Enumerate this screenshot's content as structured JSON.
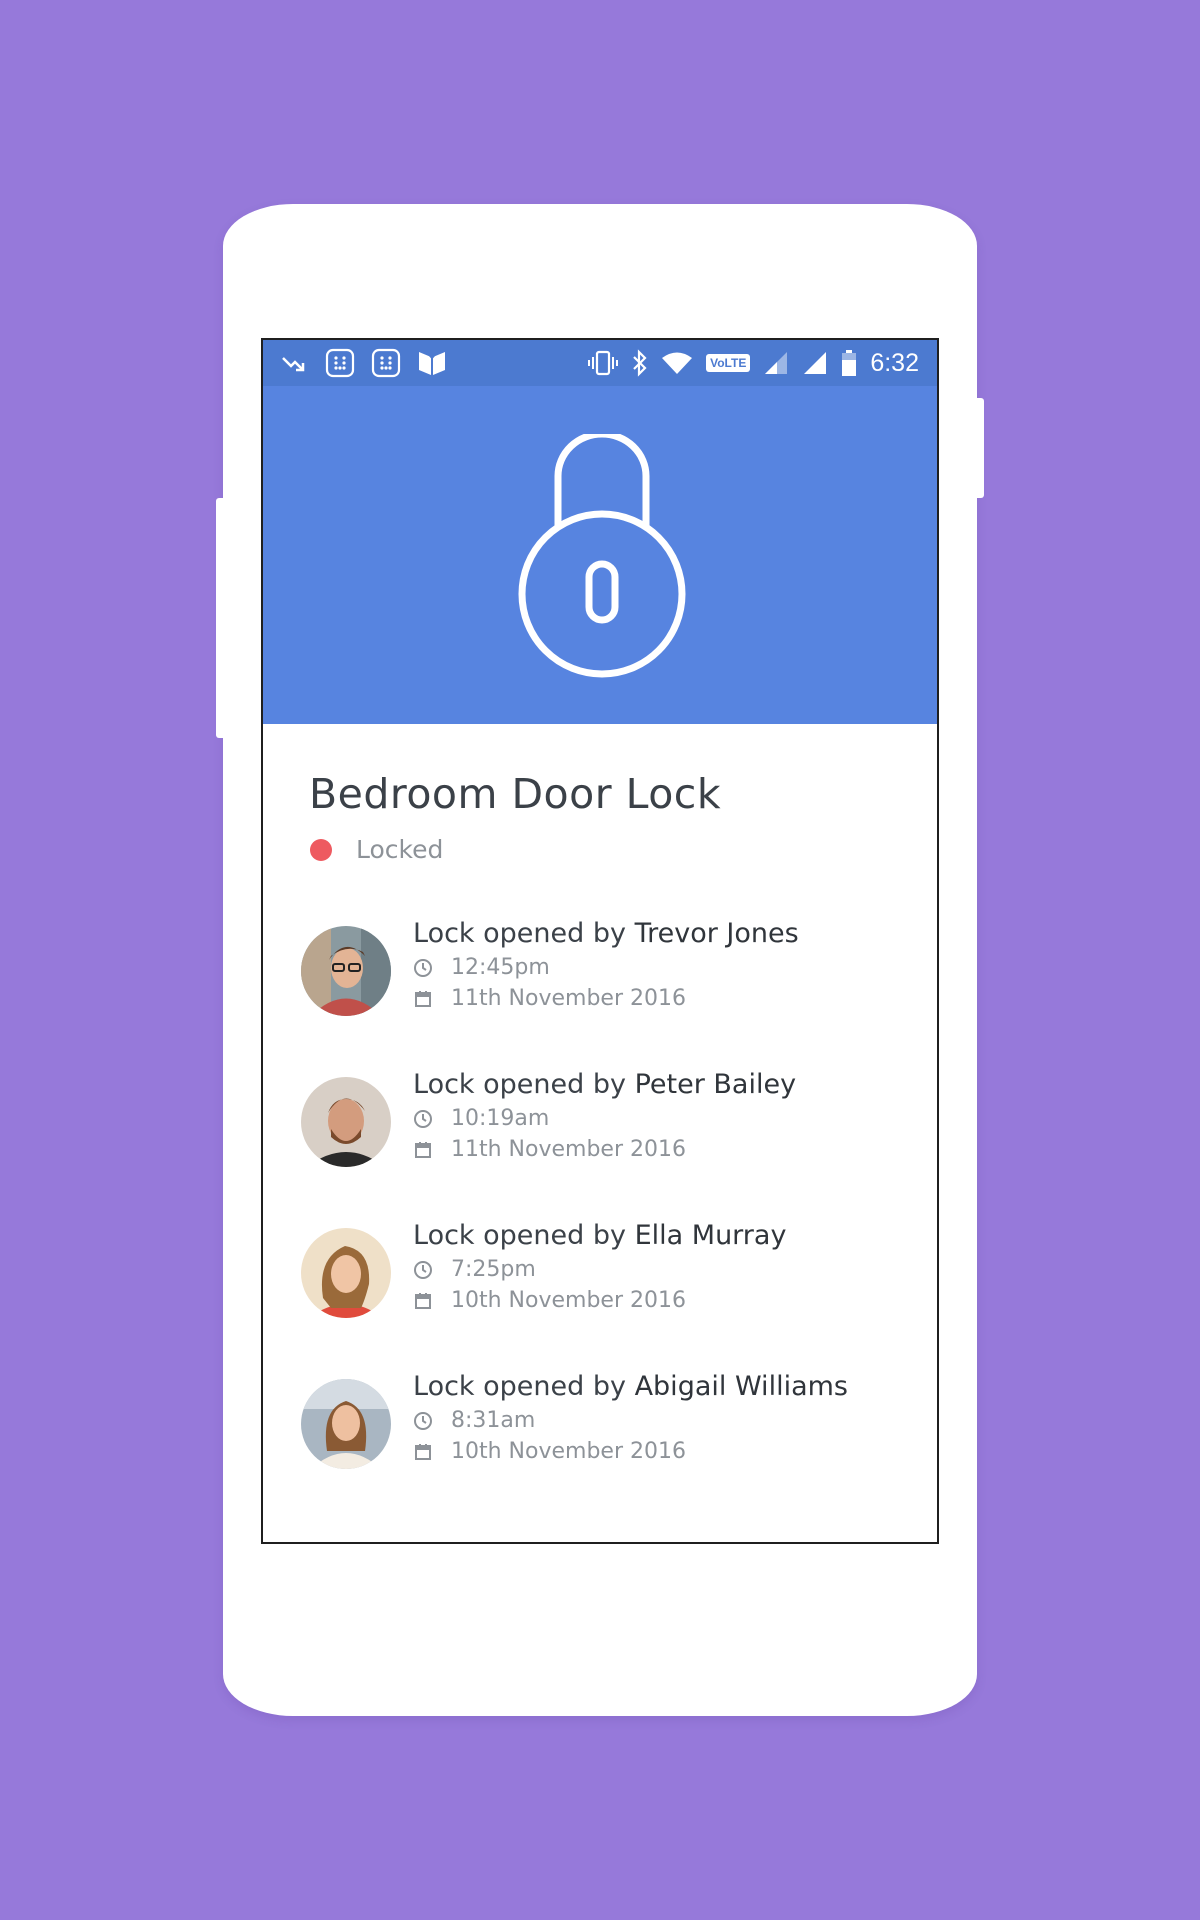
{
  "status_bar": {
    "time": "6:32",
    "network_badge": "VoLTE",
    "left_icons": [
      "missed-call-icon",
      "dialpad-icon",
      "dialpad-icon",
      "book-icon"
    ],
    "right_icons": [
      "vibrate-icon",
      "bluetooth-icon",
      "wifi-icon",
      "volte-icon",
      "signal-icon",
      "signal-icon",
      "battery-icon"
    ]
  },
  "lock": {
    "title": "Bedroom Door Lock",
    "status_label": "Locked",
    "status_color": "#ee5a60"
  },
  "activity": [
    {
      "prefix": "Lock opened by ",
      "name": "Trevor Jones",
      "time": "12:45pm",
      "date": "11th November 2016"
    },
    {
      "prefix": "Lock opened by ",
      "name": "Peter Bailey",
      "time": "10:19am",
      "date": "11th November 2016"
    },
    {
      "prefix": "Lock opened by ",
      "name": "Ella Murray",
      "time": "7:25pm",
      "date": "10th November 2016"
    },
    {
      "prefix": "Lock opened by ",
      "name": "Abigail Williams",
      "time": "8:31am",
      "date": "10th November 2016"
    }
  ],
  "colors": {
    "background": "#9679da",
    "header": "#5784e0",
    "status_bar": "#4c7ad0"
  }
}
